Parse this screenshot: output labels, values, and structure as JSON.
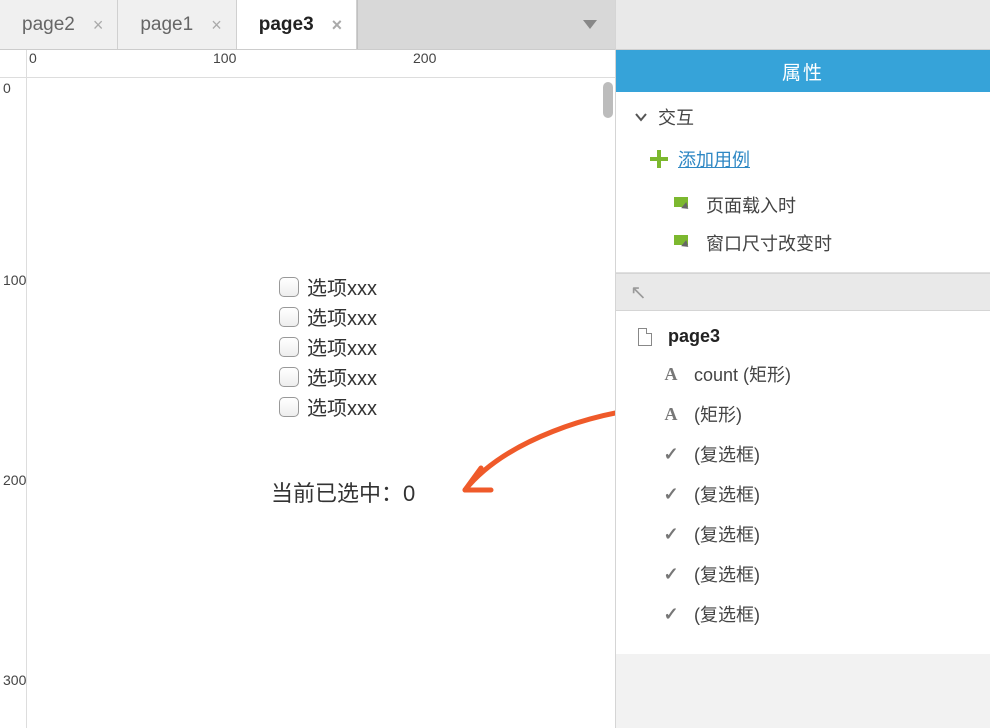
{
  "tabs": [
    {
      "label": "page2",
      "active": false
    },
    {
      "label": "page1",
      "active": false
    },
    {
      "label": "page3",
      "active": true
    }
  ],
  "ruler": {
    "h": [
      "0",
      "100",
      "200"
    ],
    "v": [
      "0",
      "100",
      "200",
      "300"
    ]
  },
  "canvas": {
    "checkboxes": [
      {
        "label": "选项xxx"
      },
      {
        "label": "选项xxx"
      },
      {
        "label": "选项xxx"
      },
      {
        "label": "选项xxx"
      },
      {
        "label": "选项xxx"
      }
    ],
    "count_label": "当前已选中：",
    "count_value": "0"
  },
  "panel": {
    "header": "属性",
    "interaction_section": "交互",
    "add_case": "添加用例",
    "events": [
      "页面载入时",
      "窗口尺寸改变时"
    ]
  },
  "outline": {
    "root": "page3",
    "items": [
      {
        "icon": "A",
        "label": "count (矩形)"
      },
      {
        "icon": "A",
        "label": "(矩形)"
      },
      {
        "icon": "chk",
        "label": "(复选框)"
      },
      {
        "icon": "chk",
        "label": "(复选框)"
      },
      {
        "icon": "chk",
        "label": "(复选框)"
      },
      {
        "icon": "chk",
        "label": "(复选框)"
      },
      {
        "icon": "chk",
        "label": "(复选框)"
      }
    ]
  }
}
